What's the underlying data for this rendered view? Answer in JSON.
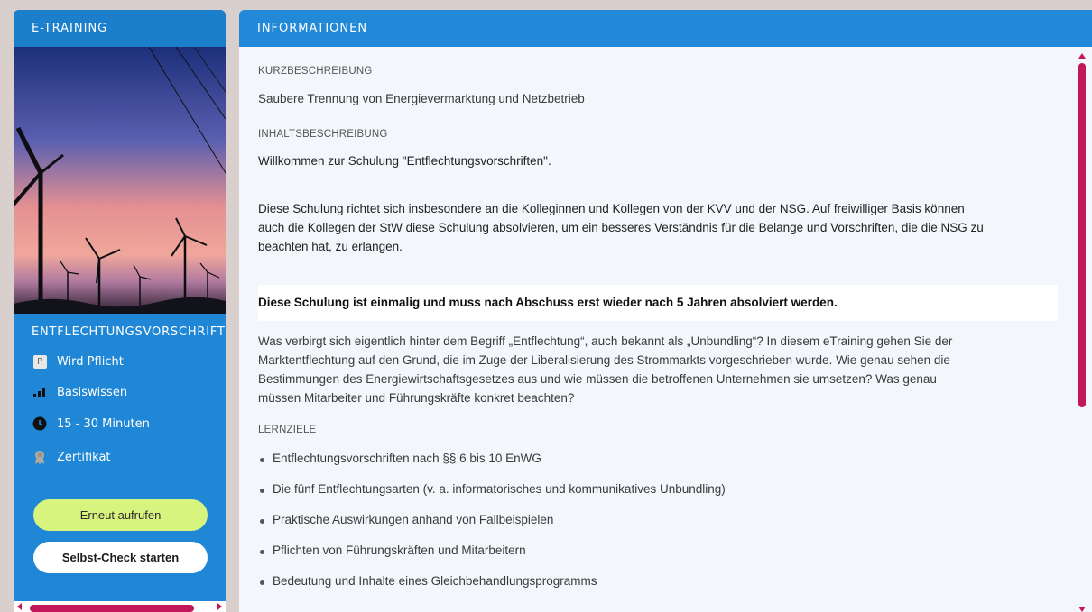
{
  "left": {
    "header": "E-TRAINING",
    "course_title": "ENTFLECHTUNGSVORSCHRIFTEN",
    "meta": [
      {
        "icon": "p-badge-icon",
        "badge": "P",
        "label": "Wird Pflicht"
      },
      {
        "icon": "signal-bars-icon",
        "label": "Basiswissen"
      },
      {
        "icon": "clock-icon",
        "label": "15 - 30 Minuten"
      },
      {
        "icon": "certificate-icon",
        "label": "Zertifikat"
      }
    ],
    "buttons": {
      "reopen": "Erneut aufrufen",
      "self_check": "Selbst-Check starten"
    }
  },
  "right": {
    "header": "INFORMATIONEN",
    "short_desc_label": "KURZBESCHREIBUNG",
    "short_desc": "Saubere Trennung von Energievermarktung und Netzbetrieb",
    "content_desc_label": "INHALTSBESCHREIBUNG",
    "welcome": "Willkommen zur Schulung \"Entflechtungsvorschriften\".",
    "audience": [
      "Diese Schulung richtet sich insbesondere an die Kolleginnen und Kollegen von der KVV und der NSG. Auf freiwilliger Basis können",
      "auch die Kollegen der StW diese Schulung absolvieren, um ein besseres Verständnis für die Belange und Vorschriften, die die NSG zu",
      "beachten hat, zu erlangen."
    ],
    "notice": "Diese Schulung ist einmalig und muss nach Abschuss erst wieder nach 5 Jahren absolviert werden.",
    "intro": [
      "Was verbirgt sich eigentlich hinter dem Begriff „Entflechtung“, auch bekannt als „Unbundling“? In diesem eTraining gehen Sie der",
      "Marktentflechtung auf den Grund, die im Zuge der Liberalisierung des Strommarkts vorgeschrieben wurde. Wie genau sehen die",
      "Bestimmungen des Energiewirtschaftsgesetzes aus und wie müssen die betroffenen Unternehmen sie umsetzen? Was genau",
      "müssen Mitarbeiter und Führungskräfte konkret beachten?"
    ],
    "goals_label": "LERNZIELE",
    "goals": [
      "Entflechtungsvorschriften nach §§ 6 bis 10 EnWG",
      "Die fünf Entflechtungsarten (v. a. informatorisches und kommunikatives Unbundling)",
      "Praktische Auswirkungen anhand von Fallbeispielen",
      "Pflichten von Führungskräften und Mitarbeitern",
      "Bedeutung und Inhalte eines Gleichbehandlungsprogramms"
    ]
  },
  "colors": {
    "panel_blue": "#1f87d6",
    "header_blue": "#2189d7",
    "accent_magenta": "#c2185b",
    "button_green": "#d7f47e"
  }
}
